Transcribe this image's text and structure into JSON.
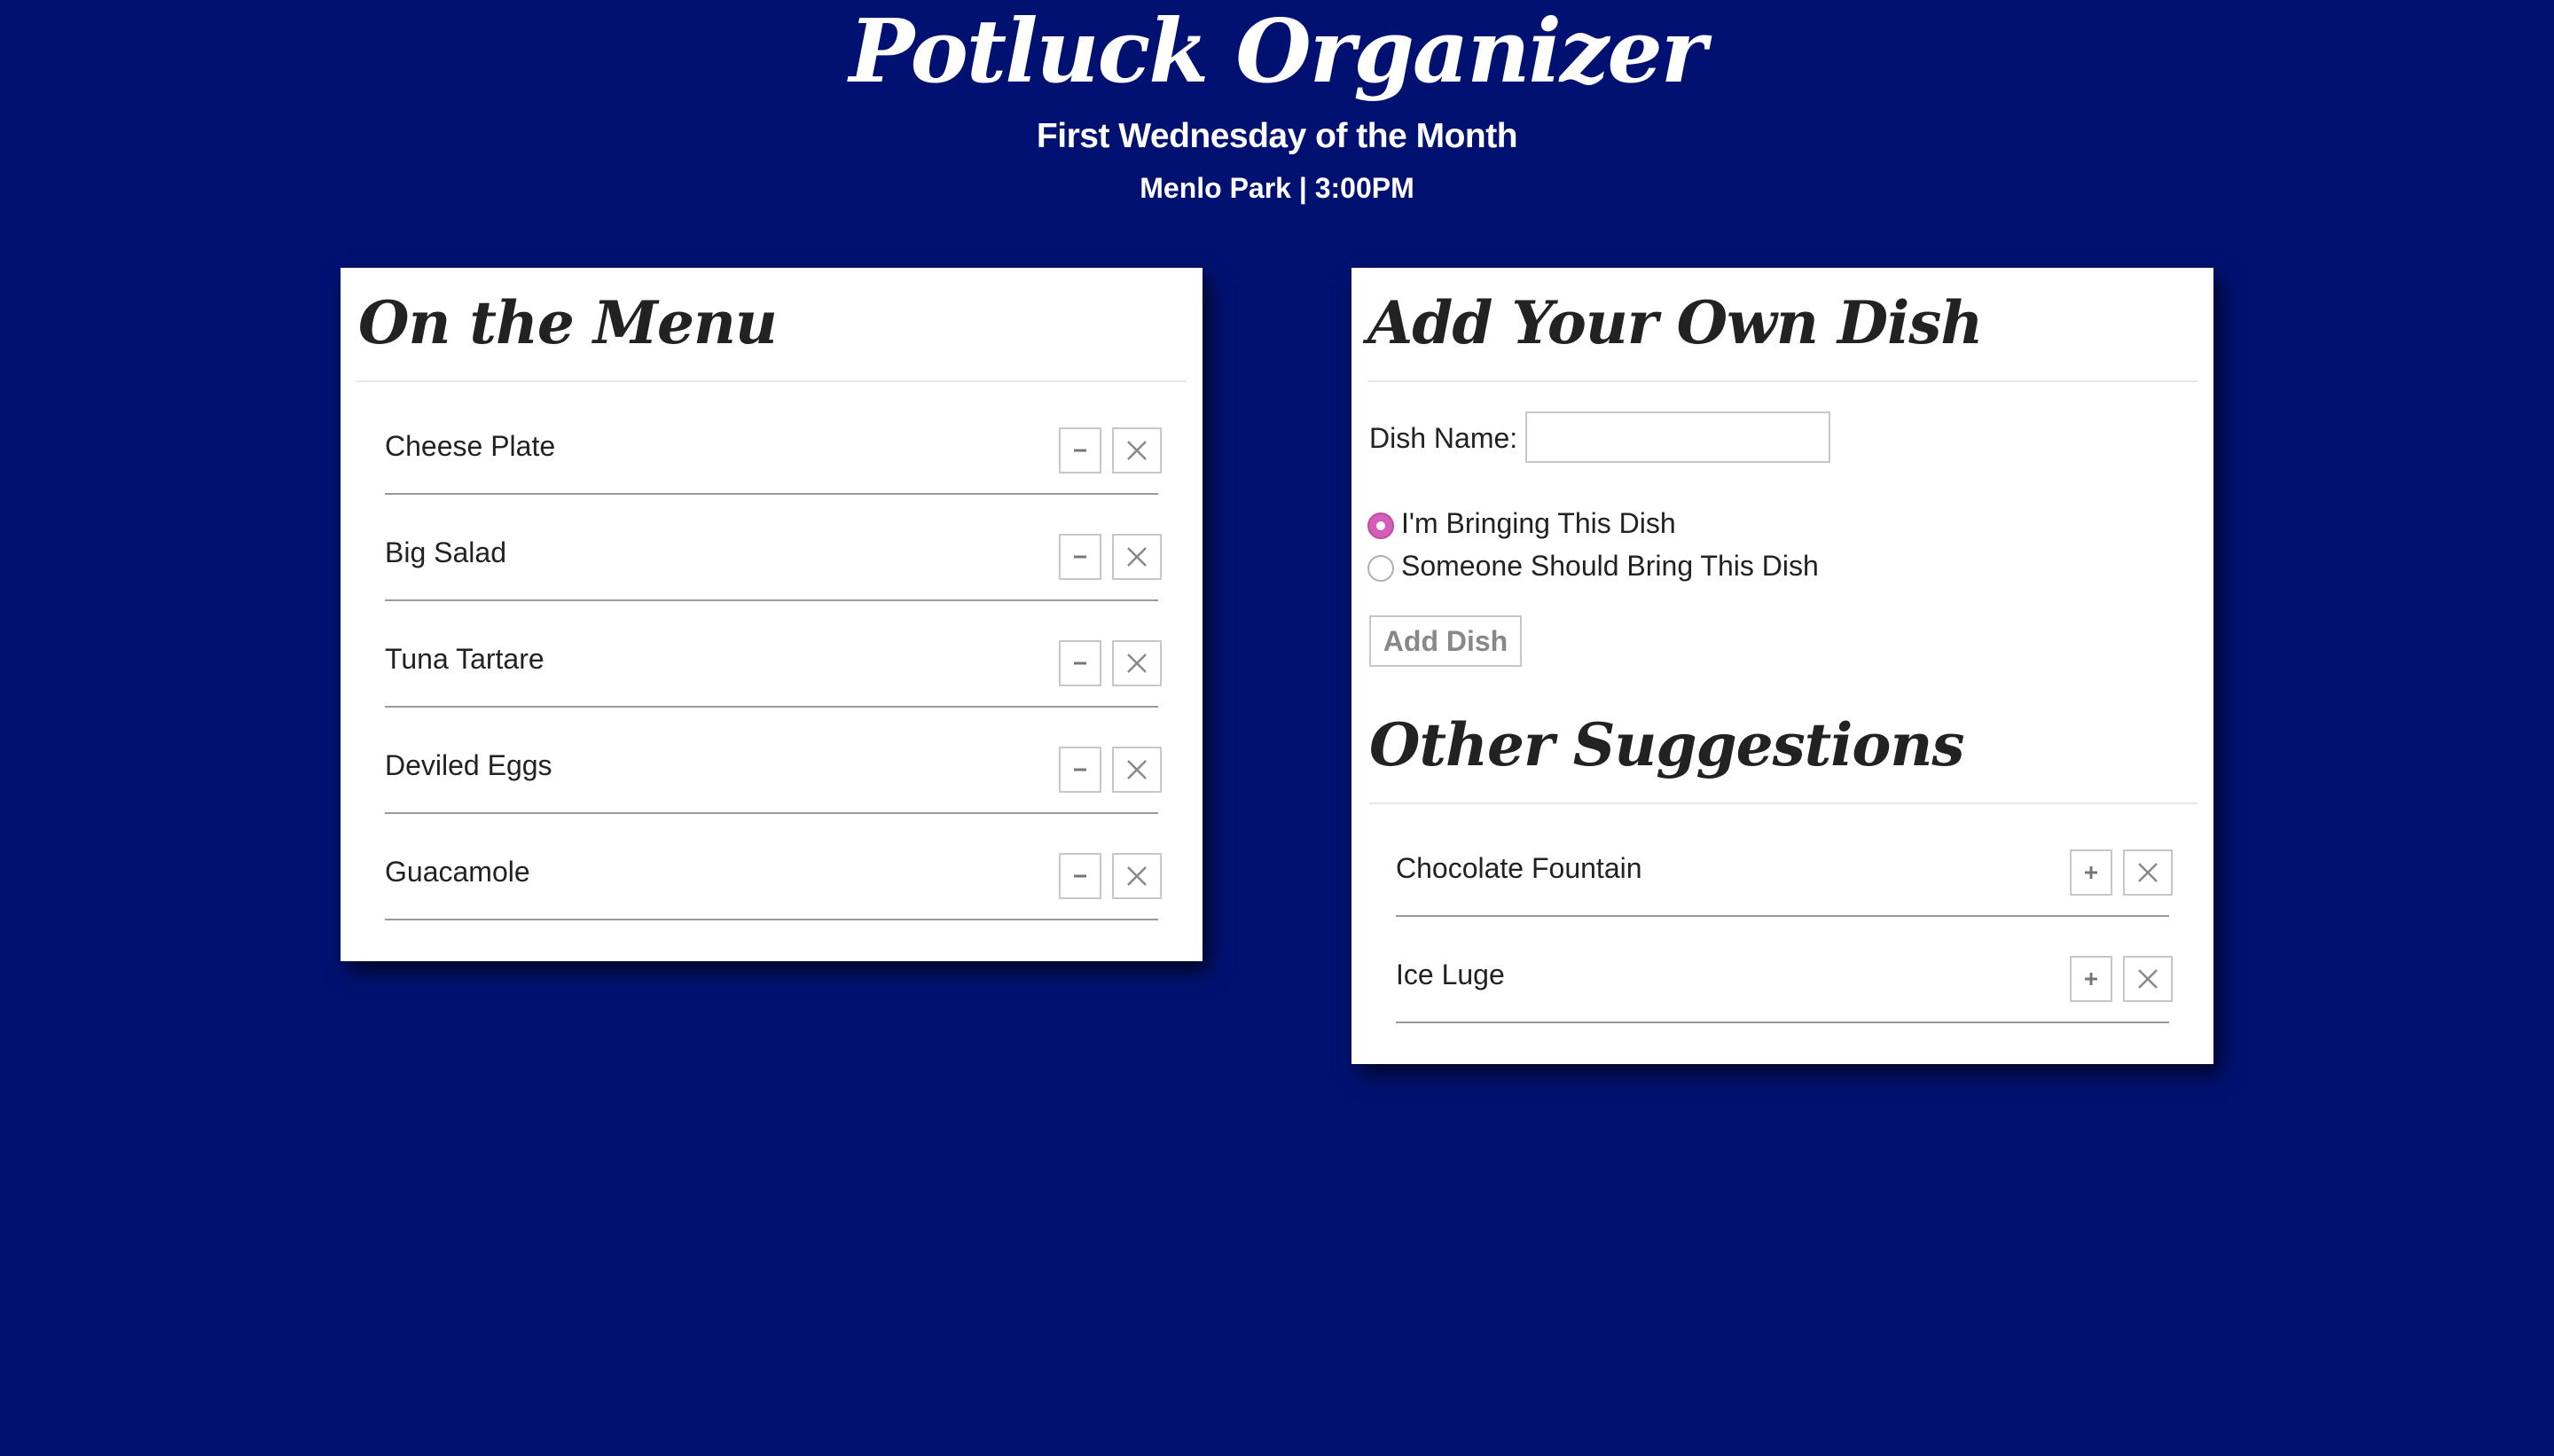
{
  "header": {
    "title": "Potluck Organizer",
    "subtitle": "First Wednesday of the Month",
    "location": "Menlo Park | 3:00PM"
  },
  "menu": {
    "heading": "On the Menu",
    "items": [
      {
        "name": "Cheese Plate",
        "action": "minus-icon",
        "remove": "close-icon"
      },
      {
        "name": "Big Salad",
        "action": "minus-icon",
        "remove": "close-icon"
      },
      {
        "name": "Tuna Tartare",
        "action": "minus-icon",
        "remove": "close-icon"
      },
      {
        "name": "Deviled Eggs",
        "action": "minus-icon",
        "remove": "close-icon"
      },
      {
        "name": "Guacamole",
        "action": "minus-icon",
        "remove": "close-icon"
      }
    ]
  },
  "add_dish": {
    "heading": "Add Your Own Dish",
    "dish_name_label": "Dish Name:",
    "dish_name_value": "",
    "options": [
      {
        "label": "I'm Bringing This Dish",
        "checked": true
      },
      {
        "label": "Someone Should Bring This Dish",
        "checked": false
      }
    ],
    "button_label": "Add Dish"
  },
  "suggestions": {
    "heading": "Other Suggestions",
    "items": [
      {
        "name": "Chocolate Fountain",
        "action": "plus-icon",
        "remove": "close-icon"
      },
      {
        "name": "Ice Luge",
        "action": "plus-icon",
        "remove": "close-icon"
      }
    ]
  },
  "colors": {
    "background": "#001172",
    "radio_accent": "#d55fb8"
  }
}
